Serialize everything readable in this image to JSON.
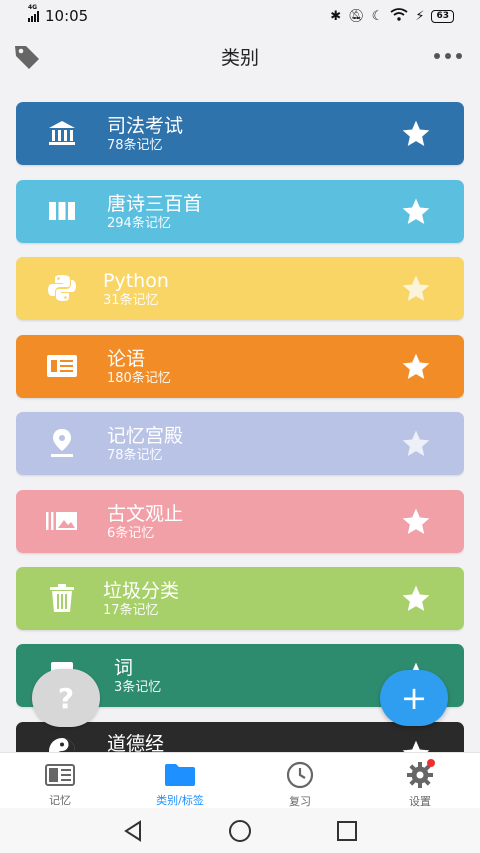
{
  "status_bar": {
    "network": "4G",
    "time": "10:05",
    "battery": "63",
    "icons": [
      "bluetooth-icon",
      "mute-icon",
      "moon-icon",
      "wifi-icon",
      "charging-icon"
    ]
  },
  "header": {
    "title": "类别",
    "left_icon": "tag-icon",
    "right_icon": "more-icon"
  },
  "categories": [
    {
      "name": "司法考试",
      "count": "78条记忆",
      "color": "#2f73ac",
      "icon": "bank-icon",
      "star_color": "#ffffff"
    },
    {
      "name": "唐诗三百首",
      "count": "294条记忆",
      "color": "#5bbfe0",
      "icon": "columns-icon",
      "star_color": "#ffffff"
    },
    {
      "name": "Python",
      "count": "31条记忆",
      "color": "#f8d565",
      "icon": "python-icon",
      "star_color": "#fbf3da"
    },
    {
      "name": "论语",
      "count": "180条记忆",
      "color": "#f28c26",
      "icon": "news-icon",
      "star_color": "#ffffff"
    },
    {
      "name": "记忆宫殿",
      "count": "78条记忆",
      "color": "#b9c3e5",
      "icon": "location-pin-icon",
      "star_color": "#eef0f8"
    },
    {
      "name": "古文观止",
      "count": "6条记忆",
      "color": "#f2a0a8",
      "icon": "image-gallery-icon",
      "star_color": "#ffffff"
    },
    {
      "name": "垃圾分类",
      "count": "17条记忆",
      "color": "#a8d06a",
      "icon": "trash-icon",
      "star_color": "#ffffff"
    },
    {
      "name": "词",
      "count": "3条记忆",
      "color": "#2e8c6e",
      "icon": "notebook-icon",
      "star_color": "#ffffff"
    },
    {
      "name": "道德经",
      "count": "",
      "color": "#2a2a2a",
      "icon": "yin-yang-icon",
      "star_color": "#ffffff"
    }
  ],
  "fab": {
    "help_label": "?",
    "add_label": "+"
  },
  "bottom_nav": [
    {
      "label": "记忆",
      "icon": "memory-card-icon",
      "active": false
    },
    {
      "label": "类别/标签",
      "icon": "folder-icon",
      "active": true
    },
    {
      "label": "复习",
      "icon": "clock-icon",
      "active": false
    },
    {
      "label": "设置",
      "icon": "gear-icon",
      "active": false
    }
  ],
  "system_nav": [
    "back-icon",
    "home-icon",
    "recents-icon"
  ]
}
